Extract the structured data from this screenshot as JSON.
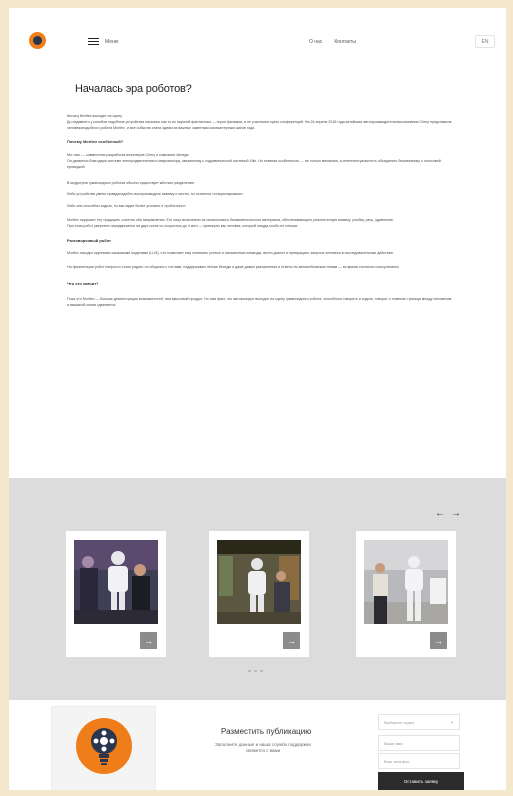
{
  "header": {
    "menu_label": "Меню",
    "nav": [
      "О нас",
      "Контакты"
    ],
    "lang": "EN"
  },
  "article": {
    "title": "Началась эра роботов?",
    "intro_1": "Китаец Moritex выходит на сцену",
    "intro_2": "До недавнего у колобов подобные устройства касались как то из научной фантастики — героя фильмов, а не участника пресс конференций. На 24 апреля 2018 года китайская автопроизводительная компания Chery представила человекоподобного робота Moritex, и все события стали одним из важных заметным компьютерным шагов года.",
    "h_why": "Почему Moritex особенный?",
    "why_1": "Мо-тикс — совместная разработка инженеров Chery и компании Aimega.",
    "why_2": "Он движется благодаря системе электродвигателям и микромотору, связанному с гидравлической системой Xilin. Но главная особенность — не только механика, а интеллектуальность объединить биомеханику с голосовой проводкой.",
    "p_1": "В индустрии гуманоидных роботов обычно существует жёсткое разделение:",
    "p_2": "Либо устройства умеют правдоподобно воспроизводить мимику и жесты, но остаются «стационарными»;",
    "p_3": "Либо они способны ходить, но выглядят более условно и «роботично».",
    "p_4": "Moritex нарушает эту традицию, сочетая оба направления. Его лицо выполнено из силиконового биомиметического материала, обеспечивающего реалистичную мимику, улыбку, речь, удивление.",
    "p_5": "При этом робот уверенно передвигается на двух ногах со скоростью до 4 км/ч — примерно как человек, который никуда особо не спешит.",
    "h_talk": "Разговорчивый робот",
    "talk_1": "Moritex находит крупными языковыми моделями (LLM), что позволяет ему понимать устные и письменные команды, вести диалог и превращать запросы человека в последовательные действия.",
    "talk_2": "На презентации робот непросто стоял рядом: он общался с гостями, поддерживал лёгкие беседы и даже давал разъяснения и ответы по автомобильным темам — во время стильного консультанта.",
    "h_means": "Что это значит?",
    "means_1": "Пока что Moritex — больше демонстрация возможностей, чем массовый продукт. Но сам факт, что автоконцерн выходит на сцену гуманоидного робота, способного говорить и ходить, говорит о главном: граница между человеком и машиной снова сдвигается."
  },
  "gallery": {
    "prev_arrow": "←",
    "next_arrow": "→",
    "card_arrow": "→"
  },
  "footer": {
    "pub_title": "Разместить публикацию",
    "pub_sub": "Заполните данные и наша служба поддержки свяжется с вами",
    "select_placeholder": "Выберите отдел",
    "name_placeholder": "Ваше имя",
    "contact_placeholder": "Ваш телефон",
    "submit_label": "Оставить заявку"
  },
  "colors": {
    "accent": "#ef7d1a",
    "dark": "#2b2b2b",
    "gallery_bg": "#dcdcdc"
  }
}
